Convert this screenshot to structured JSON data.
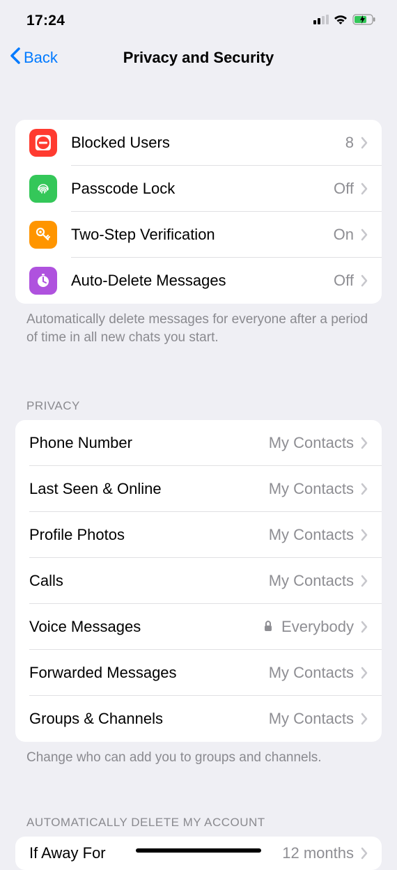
{
  "status": {
    "time": "17:24"
  },
  "nav": {
    "back_label": "Back",
    "title": "Privacy and Security"
  },
  "security_items": [
    {
      "label": "Blocked Users",
      "value": "8",
      "icon": "blocked",
      "color": "#ff3b30"
    },
    {
      "label": "Passcode Lock",
      "value": "Off",
      "icon": "fingerprint",
      "color": "#34c759"
    },
    {
      "label": "Two-Step Verification",
      "value": "On",
      "icon": "key",
      "color": "#ff9500"
    },
    {
      "label": "Auto-Delete Messages",
      "value": "Off",
      "icon": "timer",
      "color": "#af52de"
    }
  ],
  "security_footer": "Automatically delete messages for everyone after a period of time in all new chats you start.",
  "privacy_header": "PRIVACY",
  "privacy_items": [
    {
      "label": "Phone Number",
      "value": "My Contacts",
      "locked": false
    },
    {
      "label": "Last Seen & Online",
      "value": "My Contacts",
      "locked": false
    },
    {
      "label": "Profile Photos",
      "value": "My Contacts",
      "locked": false
    },
    {
      "label": "Calls",
      "value": "My Contacts",
      "locked": false
    },
    {
      "label": "Voice Messages",
      "value": "Everybody",
      "locked": true
    },
    {
      "label": "Forwarded Messages",
      "value": "My Contacts",
      "locked": false
    },
    {
      "label": "Groups & Channels",
      "value": "My Contacts",
      "locked": false
    }
  ],
  "privacy_footer": "Change who can add you to groups and channels.",
  "auto_delete_header": "AUTOMATICALLY DELETE MY ACCOUNT",
  "auto_delete": {
    "label": "If Away For",
    "value": "12 months"
  }
}
